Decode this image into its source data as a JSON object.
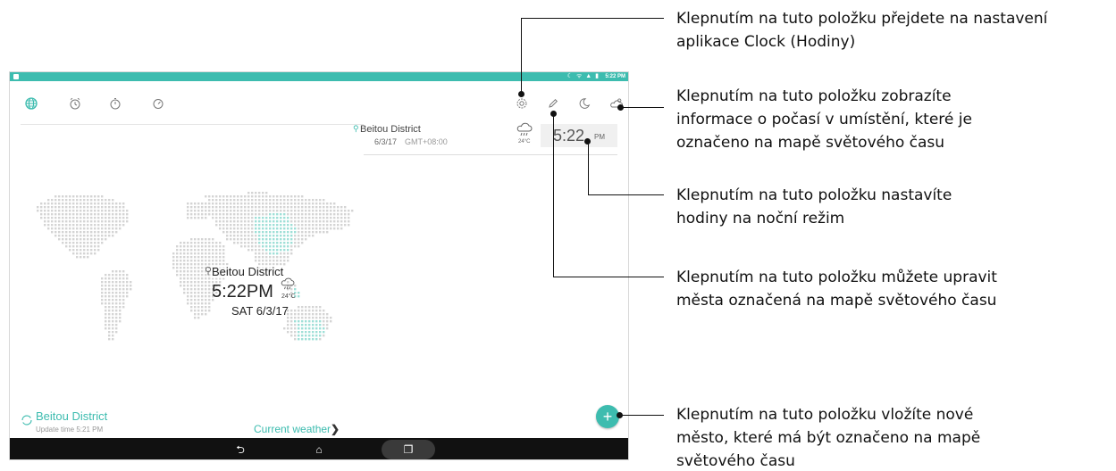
{
  "status_bar": {
    "icons": "☾ ᯤ ▲ ▮",
    "time": "5:22 PM"
  },
  "toolbar": {
    "tabs": [
      {
        "icon": "globe-icon",
        "glyph": "🌐",
        "active": true
      },
      {
        "icon": "alarm-icon",
        "glyph": "⏰"
      },
      {
        "icon": "stopwatch-icon",
        "glyph": "◷"
      },
      {
        "icon": "timer-icon",
        "glyph": "◔"
      }
    ],
    "actions": [
      {
        "icon": "settings-icon",
        "glyph": "⚙"
      },
      {
        "icon": "edit-icon",
        "glyph": "✎"
      },
      {
        "icon": "night-mode-icon",
        "glyph": "☾"
      },
      {
        "icon": "weather-icon",
        "glyph": "⛅"
      }
    ]
  },
  "city_card": {
    "name": "Beitou District",
    "date": "6/3/17",
    "gmt": "GMT+08:00",
    "temp": "24°C",
    "time": "5:22",
    "ampm": "PM"
  },
  "map_label": {
    "name": "Beitou District",
    "time": "5:22PM",
    "temp": "24°C",
    "date": "SAT 6/3/17"
  },
  "bottom": {
    "city": "Beitou District",
    "update_time": "Update time 5:21 PM",
    "current_weather": "Current weather",
    "fab": "+"
  },
  "nav": {
    "back": "⮌",
    "home": "⌂",
    "recent": "❐"
  },
  "callouts": [
    {
      "lines": [
        "Klepnutím na tuto položku přejdete na nastavení",
        "aplikace Clock (Hodiny)"
      ]
    },
    {
      "lines": [
        "Klepnutím na tuto položku zobrazíte",
        "informace o počasí v umístění, které je",
        "označeno na mapě světového času"
      ]
    },
    {
      "lines": [
        "Klepnutím na tuto položku nastavíte",
        "hodiny na noční režim"
      ]
    },
    {
      "lines": [
        "Klepnutím na tuto položku můžete upravit",
        "města označená na mapě světového času"
      ]
    },
    {
      "lines": [
        "Klepnutím na tuto položku vložíte nové",
        "město, které má být označeno na mapě",
        "světového času"
      ]
    }
  ]
}
